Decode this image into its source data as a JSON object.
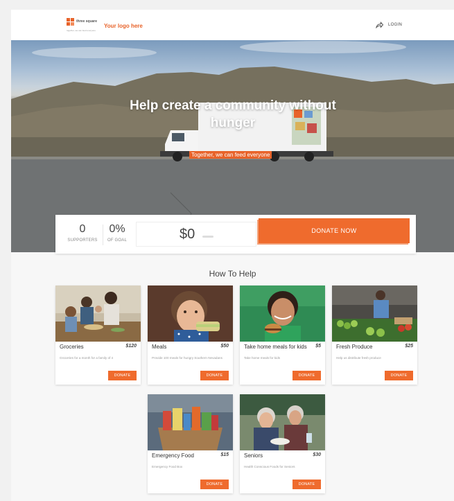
{
  "header": {
    "logo_text": "three square",
    "logo_subtext": "together, we can feed everyone",
    "your_logo": "Your logo here",
    "login_label": "LOGIN"
  },
  "hero": {
    "title": "Help create a community without hunger",
    "subtitle": "Together, we can feed everyone"
  },
  "stats": {
    "supporters_value": "0",
    "supporters_label": "SUPPORTERS",
    "goal_value": "0%",
    "goal_label": "OF GOAL",
    "amount_value": "$0",
    "donate_button": "DONATE NOW"
  },
  "how_to_help": {
    "title": "How To Help",
    "cards": [
      {
        "title": "Groceries",
        "price": "$120",
        "description": "Groceries for a month for a family of 4",
        "button": "DONATE",
        "image": "family-cooking-photo"
      },
      {
        "title": "Meals",
        "price": "$50",
        "description": "Provide 100 meals for hungry Southern Nevadans",
        "button": "DONATE",
        "image": "girl-eating-sandwich-photo"
      },
      {
        "title": "Take home meals for kids",
        "price": "$5",
        "description": "Take home meals for kids",
        "button": "DONATE",
        "image": "girl-with-burger-photo"
      },
      {
        "title": "Fresh Produce",
        "price": "$25",
        "description": "Help us distribute fresh produce",
        "button": "DONATE",
        "image": "produce-stand-photo"
      },
      {
        "title": "Emergency Food",
        "price": "$15",
        "description": "Emergency Food Box",
        "button": "DONATE",
        "image": "food-box-photo"
      },
      {
        "title": "Seniors",
        "price": "$30",
        "description": "Health Conscious Foods for Seniors",
        "button": "DONATE",
        "image": "seniors-photo"
      }
    ]
  },
  "colors": {
    "accent": "#ef6b2d",
    "brand": "#e8632a"
  }
}
